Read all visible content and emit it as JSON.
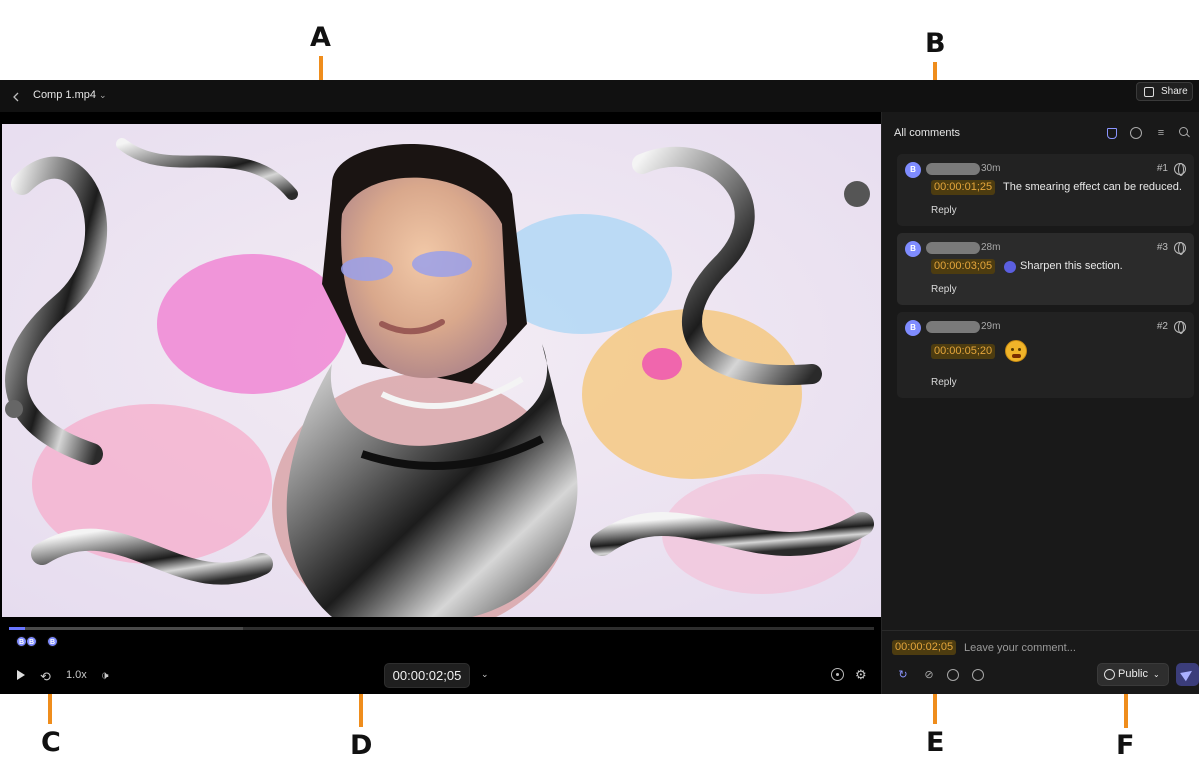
{
  "callouts": {
    "a": "A",
    "b": "B",
    "c": "C",
    "d": "D",
    "e": "E",
    "f": "F"
  },
  "header": {
    "back_icon": "chevron-left-icon",
    "file_title": "Comp 1.mp4",
    "title_chevron": "⌄",
    "share_label": "Share"
  },
  "player": {
    "progress_fraction": 0.019,
    "buffered_fraction": 0.27,
    "markers": [
      {
        "label": "B"
      },
      {
        "label": "B"
      },
      {
        "label": "B"
      }
    ],
    "speed": "1.0x",
    "timecode": "00:00:02;05",
    "timecode_dropdown": "⌄",
    "loop_glyph": "⟲",
    "volume_glyph": "🕩",
    "settings_glyph": "⚙"
  },
  "comments_panel": {
    "title": "All comments",
    "sort_glyph": "≡",
    "comments": [
      {
        "avatar": "B",
        "time_ago": "30m",
        "number": "#1",
        "timestamp": "00:00:01;25",
        "text": "The smearing effect can be reduced.",
        "reply_label": "Reply"
      },
      {
        "avatar": "B",
        "time_ago": "28m",
        "number": "#3",
        "timestamp": "00:00:03;05",
        "text": "Sharpen this section.",
        "reply_label": "Reply"
      },
      {
        "avatar": "B",
        "time_ago": "29m",
        "number": "#2",
        "timestamp": "00:00:05;20",
        "text": "",
        "reply_label": "Reply"
      }
    ],
    "composer": {
      "timestamp": "00:00:02;05",
      "placeholder": "Leave your comment...",
      "annotate_glyph": "↻",
      "attach_glyph": "⊘",
      "visibility_label": "Public",
      "visibility_chevron": "⌄"
    }
  },
  "colors": {
    "accent": "#7f8cff",
    "timestamp_text": "#e4a53b",
    "callout_line": "#ef8d1c"
  }
}
